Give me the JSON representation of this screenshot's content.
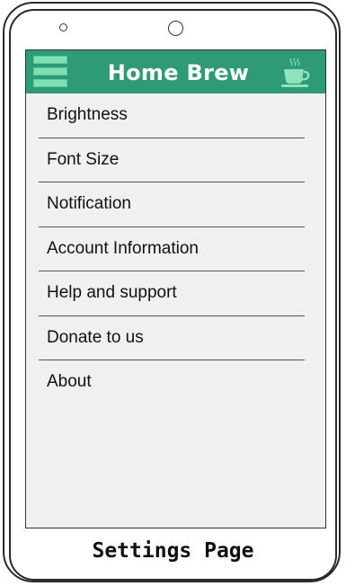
{
  "header": {
    "title": "Home Brew",
    "background_color": "#2e9b76",
    "menu_icon": "hamburger-menu-icon",
    "right_icon": "coffee-cup-icon"
  },
  "settings_menu": {
    "items": [
      {
        "label": "Brightness"
      },
      {
        "label": "Font Size"
      },
      {
        "label": "Notification"
      },
      {
        "label": "Account Information"
      },
      {
        "label": "Help and support"
      },
      {
        "label": "Donate to us"
      },
      {
        "label": "About"
      }
    ]
  },
  "footer": {
    "caption": "Settings Page"
  }
}
